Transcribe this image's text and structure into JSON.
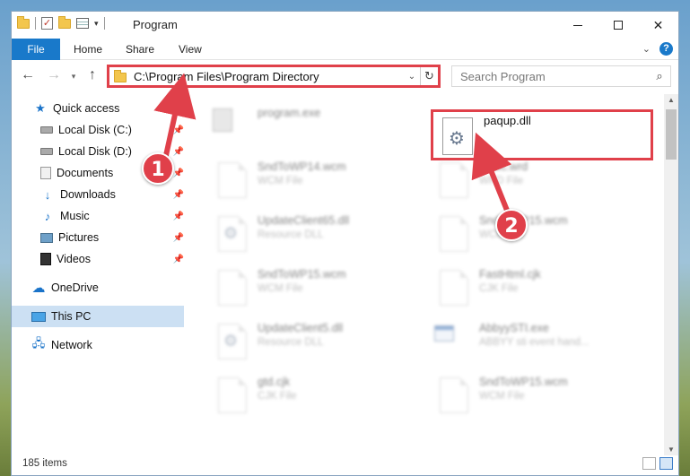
{
  "window": {
    "title": "Program"
  },
  "ribbon": {
    "tabs": [
      "File",
      "Home",
      "Share",
      "View"
    ],
    "help": "?"
  },
  "nav": {
    "address": "C:\\Program Files\\Program Directory",
    "search_placeholder": "Search Program"
  },
  "sidebar": {
    "items": [
      {
        "label": "Quick access",
        "icon": "star-icon"
      },
      {
        "label": "Local Disk (C:)",
        "icon": "disk-icon",
        "pinned": true
      },
      {
        "label": "Local Disk (D:)",
        "icon": "disk-icon",
        "pinned": true
      },
      {
        "label": "Documents",
        "icon": "documents-icon",
        "pinned": true
      },
      {
        "label": "Downloads",
        "icon": "download-icon",
        "pinned": true
      },
      {
        "label": "Music",
        "icon": "music-icon",
        "pinned": true
      },
      {
        "label": "Pictures",
        "icon": "pictures-icon",
        "pinned": true
      },
      {
        "label": "Videos",
        "icon": "videos-icon",
        "pinned": true
      },
      {
        "label": "OneDrive",
        "icon": "cloud-icon"
      },
      {
        "label": "This PC",
        "icon": "pc-icon",
        "selected": true
      },
      {
        "label": "Network",
        "icon": "network-icon"
      }
    ]
  },
  "files": {
    "left": [
      {
        "name": "program.exe",
        "type": ""
      },
      {
        "name": "SndToWP14.wcm",
        "type": "WCM File"
      },
      {
        "name": "UpdateClient65.dll",
        "type": "Resource DLL"
      },
      {
        "name": "SndToWP15.wcm",
        "type": "WCM File"
      },
      {
        "name": "UpdateClient5.dll",
        "type": "Resource DLL"
      },
      {
        "name": "gtd.cjk",
        "type": "CJK File"
      }
    ],
    "right": [
      {
        "name": "paqup.dll",
        "type": ""
      },
      {
        "name": "Basic.wrd",
        "type": "WRD File"
      },
      {
        "name": "SndToWP15.wcm",
        "type": "WCM File"
      },
      {
        "name": "FastHtml.cjk",
        "type": "CJK File"
      },
      {
        "name": "AbbyySTI.exe",
        "type": "ABBYY sti event hand..."
      },
      {
        "name": "SndToWP15.wcm",
        "type": "WCM File"
      }
    ]
  },
  "status": {
    "count": "185 items"
  },
  "callouts": [
    "1",
    "2"
  ],
  "colors": {
    "accent": "#1979ca",
    "highlight": "#e0404a",
    "selected": "#cce0f3"
  }
}
